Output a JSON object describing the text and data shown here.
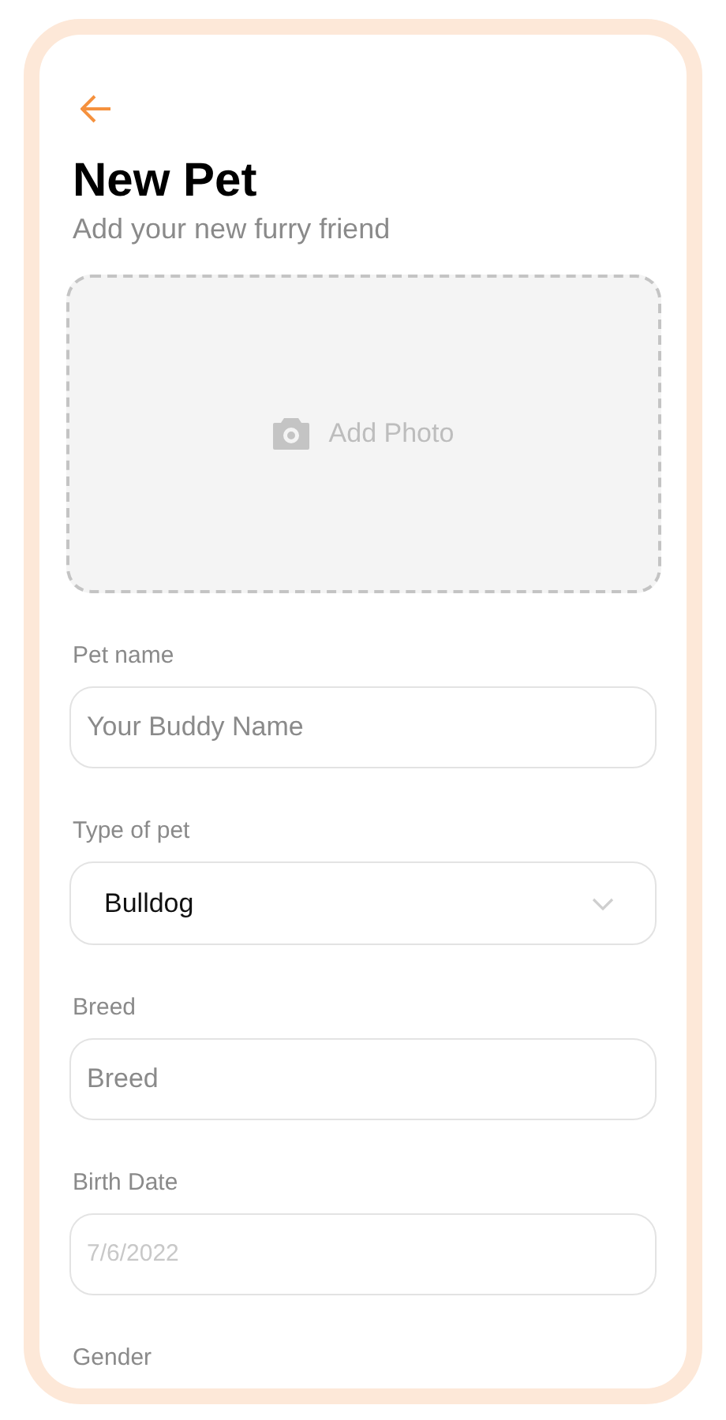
{
  "header": {
    "title": "New Pet",
    "subtitle": "Add your new furry friend"
  },
  "photo": {
    "label": "Add Photo"
  },
  "fields": [
    {
      "kind": "text",
      "label": "Pet name",
      "placeholder": "Your Buddy Name"
    },
    {
      "kind": "select",
      "label": "Type of pet",
      "value": "Bulldog"
    },
    {
      "kind": "text",
      "label": "Breed",
      "placeholder": "Breed"
    },
    {
      "kind": "date",
      "label": "Birth Date",
      "placeholder": "7/6/2022"
    },
    {
      "kind": "label",
      "label": "Gender"
    }
  ]
}
